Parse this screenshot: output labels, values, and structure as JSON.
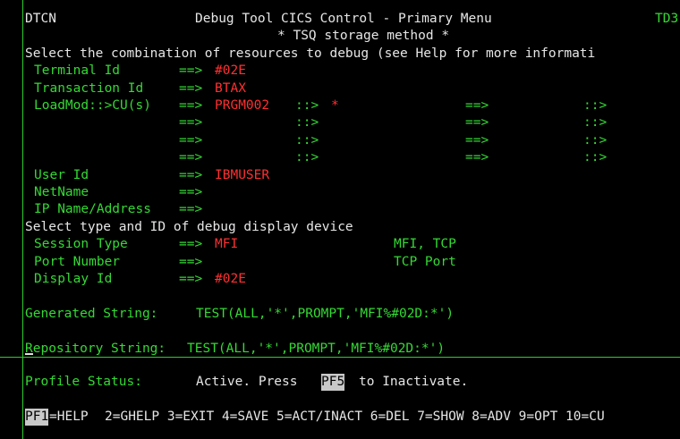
{
  "header": {
    "transaction": "DTCN",
    "title": "Debug Tool CICS Control - Primary Menu",
    "terminal_right": "TD3",
    "subtitle": "* TSQ storage method *"
  },
  "resources": {
    "instruction": "Select the combination of resources to debug (see Help for more informati",
    "terminal_id": {
      "label": "Terminal Id",
      "arrow": "==>",
      "value": "#02E"
    },
    "transaction_id": {
      "label": "Transaction Id",
      "arrow": "==>",
      "value": "BTAX"
    },
    "loadmod": {
      "label": "LoadMod::>CU(s)",
      "rows": [
        {
          "arrow1": "==>",
          "prog1": "PRGM002",
          "sep1": "::>",
          "cu1": "*",
          "arrow2": "==>",
          "sep2": "::>"
        },
        {
          "arrow1": "==>",
          "prog1": "",
          "sep1": "::>",
          "cu1": "",
          "arrow2": "==>",
          "sep2": "::>"
        },
        {
          "arrow1": "==>",
          "prog1": "",
          "sep1": "::>",
          "cu1": "",
          "arrow2": "==>",
          "sep2": "::>"
        },
        {
          "arrow1": "==>",
          "prog1": "",
          "sep1": "::>",
          "cu1": "",
          "arrow2": "==>",
          "sep2": "::>"
        }
      ]
    },
    "user_id": {
      "label": "User Id",
      "arrow": "==>",
      "value": "IBMUSER"
    },
    "netname": {
      "label": "NetName",
      "arrow": "==>",
      "value": ""
    },
    "ip_address": {
      "label": "IP Name/Address",
      "arrow": "==>",
      "value": ""
    }
  },
  "display_device": {
    "instruction": "Select type and ID of debug display device",
    "session_type": {
      "label": "Session Type",
      "arrow": "==>",
      "value": "MFI",
      "hint": "MFI, TCP"
    },
    "port_number": {
      "label": "Port Number",
      "arrow": "==>",
      "value": "",
      "hint": "TCP Port"
    },
    "display_id": {
      "label": "Display Id",
      "arrow": "==>",
      "value": "#02E"
    }
  },
  "strings": {
    "generated_label": "Generated String:",
    "generated_value": "TEST(ALL,'*',PROMPT,'MFI%#02D:*')",
    "repository_label": "Repository String:",
    "repository_value": "TEST(ALL,'*',PROMPT,'MFI%#02D:*')"
  },
  "profile": {
    "label": "Profile Status:",
    "text_before": "Active. Press",
    "key": "PF5",
    "text_after": "to Inactivate."
  },
  "function_keys": {
    "pf1_key": "PF1",
    "pf1_label": "=HELP",
    "rest": "2=GHELP 3=EXIT 4=SAVE 5=ACT/INACT 6=DEL 7=SHOW 8=ADV 9=OPT 10=CU"
  },
  "colors": {
    "background": "#000000",
    "green": "#34d934",
    "white": "#e6e6e6",
    "red": "#ff3030",
    "highlight": "#c8c8c8"
  }
}
